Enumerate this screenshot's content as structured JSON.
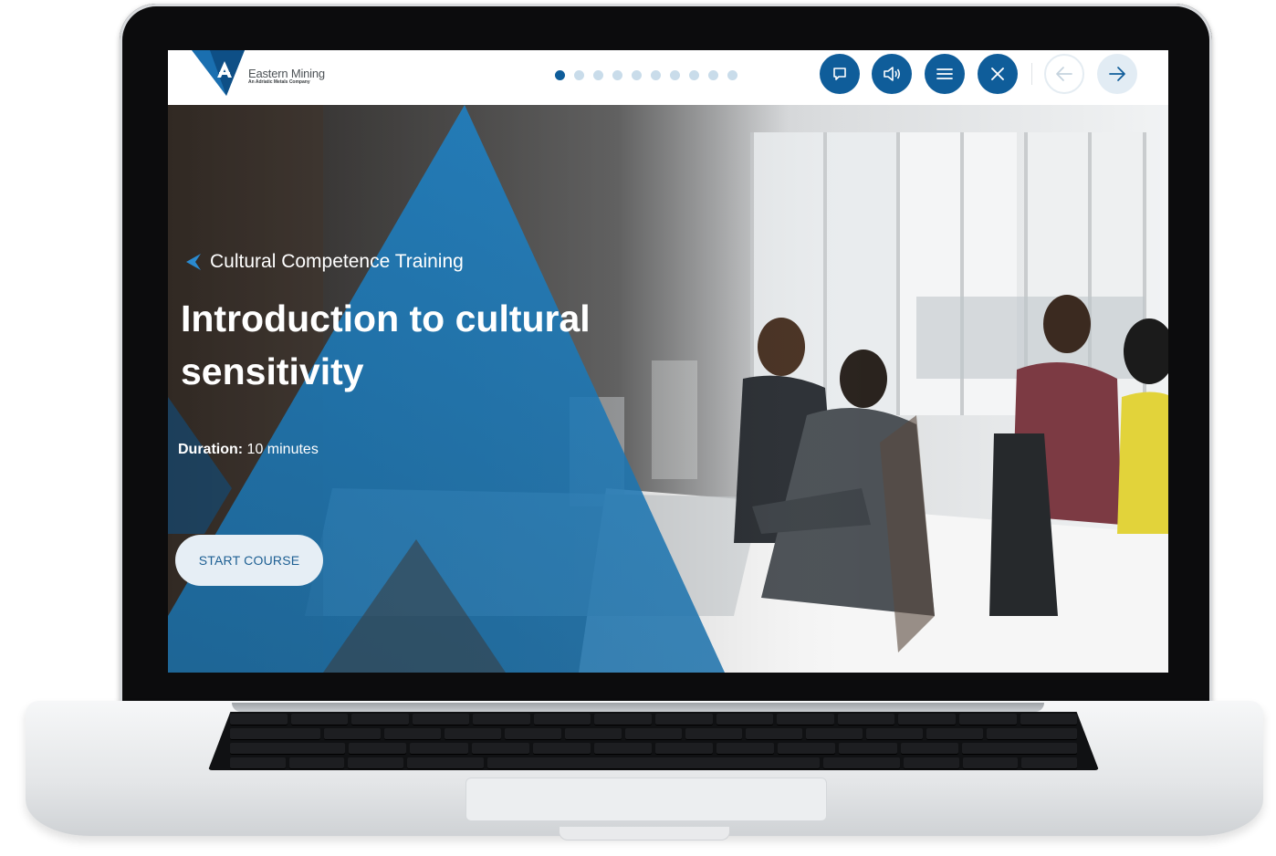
{
  "header": {
    "logo_name": "Eastern Mining",
    "logo_subtitle": "An Adriatic Metals Company",
    "progress": {
      "total_slides": 10,
      "current_slide": 1
    },
    "buttons": {
      "transcript": "chat-bubble-icon",
      "audio": "speaker-icon",
      "menu": "hamburger-menu-icon",
      "close": "close-icon",
      "prev": "arrow-left-icon",
      "next": "arrow-right-icon"
    }
  },
  "hero": {
    "kicker": "Cultural Competence Training",
    "title": "Introduction to cultural sensitivity",
    "duration_label": "Duration:",
    "duration_value": " 10 minutes",
    "start_label": "START COURSE"
  },
  "colors": {
    "brand_blue": "#0f5d9a",
    "triangle_blue": "#1a7bbd",
    "button_light": "#e6eef5"
  }
}
